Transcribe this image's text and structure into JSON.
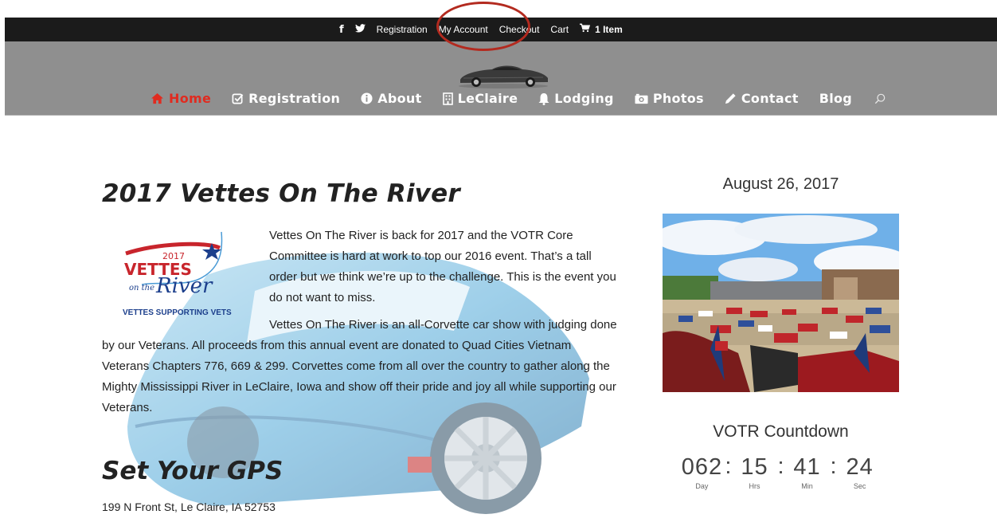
{
  "topbar": {
    "facebook_icon": "f",
    "twitter_icon": "twitter-bird",
    "links": [
      "Registration",
      "My Account",
      "Checkout",
      "Cart"
    ],
    "cart_count": "1 Item"
  },
  "nav": {
    "items": [
      {
        "label": "Home",
        "icon": "home-icon",
        "active": true
      },
      {
        "label": "Registration",
        "icon": "check-square-icon"
      },
      {
        "label": "About",
        "icon": "info-icon"
      },
      {
        "label": "LeClaire",
        "icon": "building-icon"
      },
      {
        "label": "Lodging",
        "icon": "bell-icon"
      },
      {
        "label": "Photos",
        "icon": "camera-icon"
      },
      {
        "label": "Contact",
        "icon": "pencil-icon"
      },
      {
        "label": "Blog",
        "icon": ""
      }
    ],
    "accent_color": "#e02b20"
  },
  "main": {
    "title": "2017 Vettes On The River",
    "logo": {
      "year": "2017",
      "line1": "VETTES",
      "line2a": "on the",
      "line2b": "River",
      "tagline": "VETTES SUPPORTING VETS"
    },
    "para1": "Vettes On The River is back for 2017 and the VOTR Core Committee is hard at work to top our 2016 event. That’s a tall order but we think we’re up to the challenge. This is the event you do not want to miss.",
    "para2": "Vettes On The River is an all-Corvette car show with judging done by our Veterans. All proceeds from this annual event are donated to Quad Cities Vietnam Veterans Chapters 776, 669 & 299. Corvettes come from all over the country to gather along the Mighty Mississippi River in LeClaire, Iowa and show off their pride and joy all while supporting our Veterans.",
    "gps_heading": "Set Your GPS",
    "address": "199 N Front St, Le Claire, IA 52753"
  },
  "sidebar": {
    "date": "August 26, 2017",
    "countdown_title": "VOTR Countdown",
    "countdown": [
      {
        "value": "062",
        "label": "Day"
      },
      {
        "value": "15",
        "label": "Hrs"
      },
      {
        "value": "41",
        "label": "Min"
      },
      {
        "value": "24",
        "label": "Sec"
      }
    ]
  }
}
